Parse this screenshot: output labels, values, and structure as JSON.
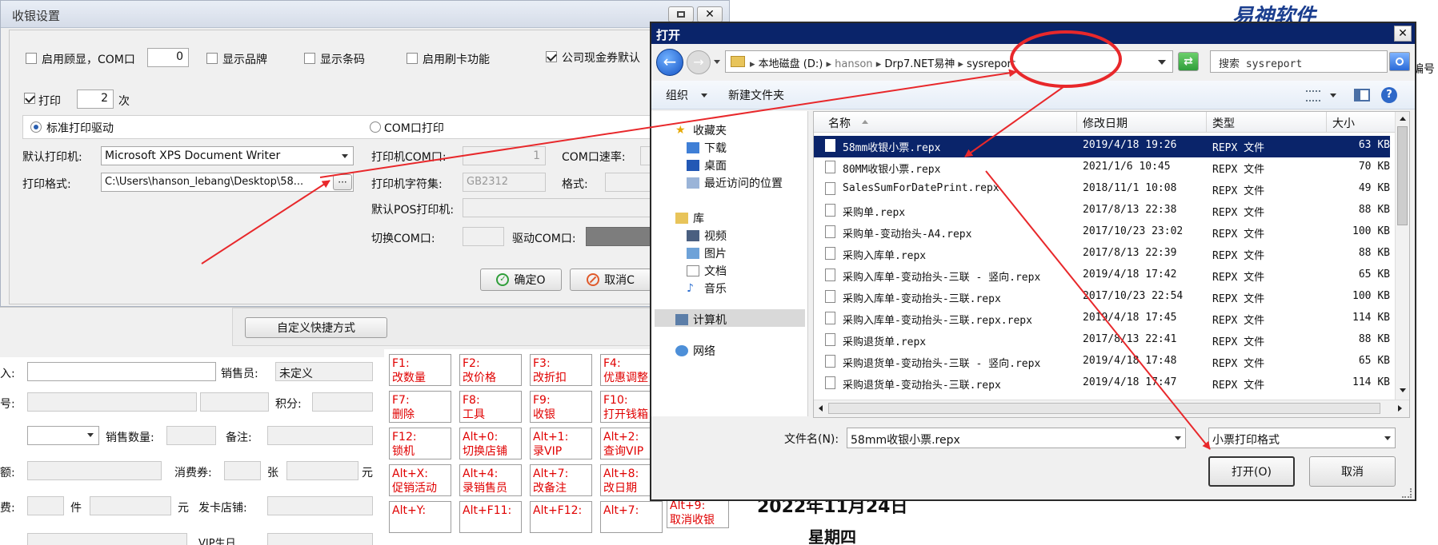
{
  "settings_dialog": {
    "title": "收银设置",
    "row1": {
      "customer_display": "启用顾显，COM口",
      "com_value": "0",
      "show_brand": "显示品牌",
      "show_barcode": "显示条码",
      "card_swipe": "启用刷卡功能",
      "coupon_default": "公司现金券默认"
    },
    "print_label": "打印",
    "print_count": "2",
    "times_label": "次",
    "std_driver": "标准打印驱动",
    "com_print": "COM口打印",
    "default_printer_label": "默认打印机:",
    "default_printer_value": "Microsoft XPS Document Writer",
    "print_format_label": "打印格式:",
    "print_format_value": "C:\\Users\\hanson_lebang\\Desktop\\58...",
    "printer_com_label": "打印机COM口:",
    "printer_com_value": "1",
    "com_rate_label": "COM口速率:",
    "charset_label": "打印机字符集:",
    "charset_value": "GB2312",
    "format_label": "格式:",
    "default_pos_label": "默认POS打印机:",
    "switch_com_label": "切换COM口:",
    "driver_com_label": "驱动COM口:",
    "ok_button": "确定O",
    "cancel_button": "取消C"
  },
  "pos_panel": {
    "custom_shortcut": "自定义快捷方式",
    "fields": {
      "salesperson": "销售员:",
      "salesperson_value": "未定义",
      "points": "积分:",
      "sales_qty": "销售数量:",
      "remark": "备注:",
      "coupon": "消费券:",
      "zhang": "张",
      "yuan": "元",
      "jian": "件",
      "yuan2": "元",
      "issue_store": "发卡店铺:",
      "frag_ru": "入:",
      "frag_hao": "号:",
      "frag_e": "额:",
      "frag_fei": "费:",
      "frag_vip": "VIP生日"
    },
    "keys": [
      [
        "F1:",
        "改数量"
      ],
      [
        "F2:",
        "改价格"
      ],
      [
        "F3:",
        "改折扣"
      ],
      [
        "F4:",
        "优惠调整"
      ],
      [
        "F7:",
        "删除"
      ],
      [
        "F8:",
        "工具"
      ],
      [
        "F9:",
        "收银"
      ],
      [
        "F10:",
        "打开钱箱"
      ],
      [
        "F12:",
        "锁机"
      ],
      [
        "Alt+0:",
        "切换店铺"
      ],
      [
        "Alt+1:",
        "录VIP"
      ],
      [
        "Alt+2:",
        "查询VIP"
      ],
      [
        "Alt+X:",
        "促销活动"
      ],
      [
        "Alt+4:",
        "录销售员"
      ],
      [
        "Alt+7:",
        "改备注"
      ],
      [
        "Alt+8:",
        "改日期"
      ],
      [
        "Alt+Y:",
        ""
      ],
      [
        "Alt+F11:",
        ""
      ],
      [
        "Alt+F12:",
        ""
      ],
      [
        "Alt+7:",
        ""
      ]
    ],
    "alt9_key": [
      "Alt+9:",
      "取消收银"
    ]
  },
  "background": {
    "brand": "易神软件",
    "right_fragment": "编号",
    "date": "2022年11月24日",
    "weekday": "星期四"
  },
  "open_dialog": {
    "title": "打开",
    "breadcrumb": [
      "本地磁盘 (D:)",
      "hanson",
      "Drp7.NET易神",
      "sysreport"
    ],
    "search_placeholder": "搜索 sysreport",
    "organize": "组织",
    "new_folder": "新建文件夹",
    "nav": {
      "favorites": "收藏夹",
      "downloads": "下载",
      "desktop": "桌面",
      "recent": "最近访问的位置",
      "libraries": "库",
      "videos": "视频",
      "pictures": "图片",
      "documents": "文档",
      "music": "音乐",
      "computer": "计算机",
      "network": "网络"
    },
    "columns": {
      "name": "名称",
      "modified": "修改日期",
      "type": "类型",
      "size": "大小"
    },
    "files": [
      {
        "name": "58mm收银小票.repx",
        "date": "2019/4/18 19:26",
        "type": "REPX 文件",
        "size": "63 KB"
      },
      {
        "name": "80MM收银小票.repx",
        "date": "2021/1/6 10:45",
        "type": "REPX 文件",
        "size": "70 KB"
      },
      {
        "name": "SalesSumForDatePrint.repx",
        "date": "2018/11/1 10:08",
        "type": "REPX 文件",
        "size": "49 KB"
      },
      {
        "name": "采购单.repx",
        "date": "2017/8/13 22:38",
        "type": "REPX 文件",
        "size": "88 KB"
      },
      {
        "name": "采购单-变动抬头-A4.repx",
        "date": "2017/10/23 23:02",
        "type": "REPX 文件",
        "size": "100 KB"
      },
      {
        "name": "采购入库单.repx",
        "date": "2017/8/13 22:39",
        "type": "REPX 文件",
        "size": "88 KB"
      },
      {
        "name": "采购入库单-变动抬头-三联 - 竖向.repx",
        "date": "2019/4/18 17:42",
        "type": "REPX 文件",
        "size": "65 KB"
      },
      {
        "name": "采购入库单-变动抬头-三联.repx",
        "date": "2017/10/23 22:54",
        "type": "REPX 文件",
        "size": "100 KB"
      },
      {
        "name": "采购入库单-变动抬头-三联.repx.repx",
        "date": "2019/4/18 17:45",
        "type": "REPX 文件",
        "size": "114 KB"
      },
      {
        "name": "采购退货单.repx",
        "date": "2017/8/13 22:41",
        "type": "REPX 文件",
        "size": "88 KB"
      },
      {
        "name": "采购退货单-变动抬头-三联 - 竖向.repx",
        "date": "2019/4/18 17:48",
        "type": "REPX 文件",
        "size": "65 KB"
      },
      {
        "name": "采购退货单-变动抬头-三联.repx",
        "date": "2019/4/18 17:47",
        "type": "REPX 文件",
        "size": "114 KB"
      }
    ],
    "filename_label": "文件名(N):",
    "filename_value": "58mm收银小票.repx",
    "filter_value": "小票打印格式",
    "open_button": "打开(O)",
    "cancel_button": "取消"
  },
  "colors": {
    "annotation": "#e8282b",
    "selection": "#0a246a",
    "key_text": "#e00000"
  }
}
